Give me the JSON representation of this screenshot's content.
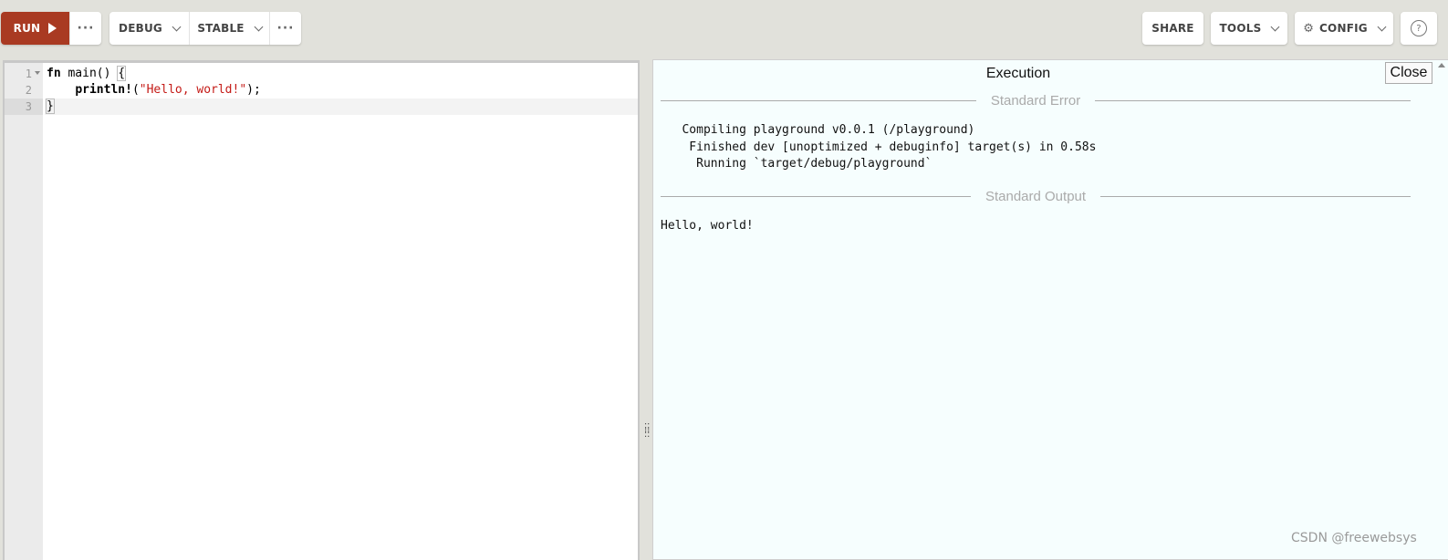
{
  "toolbar": {
    "run_label": "RUN",
    "run_more": "···",
    "mode_label": "DEBUG",
    "channel_label": "STABLE",
    "build_more": "···",
    "share_label": "SHARE",
    "tools_label": "TOOLS",
    "config_label": "CONFIG",
    "help_glyph": "?"
  },
  "editor": {
    "line_numbers": [
      "1",
      "2",
      "3"
    ],
    "code": {
      "line1_kw": "fn",
      "line1_rest": " main() ",
      "line1_brace": "{",
      "line2_indent": "    ",
      "line2_macro": "println!",
      "line2_open": "(",
      "line2_str": "\"Hello, world!\"",
      "line2_close": ");",
      "line3_brace": "}"
    }
  },
  "output": {
    "title": "Execution",
    "close_label": "Close",
    "stderr_label": "Standard Error",
    "stderr_lines": [
      "   Compiling playground v0.0.1 (/playground)",
      "    Finished dev [unoptimized + debuginfo] target(s) in 0.58s",
      "     Running `target/debug/playground`"
    ],
    "stdout_label": "Standard Output",
    "stdout_lines": [
      "Hello, world!"
    ]
  },
  "watermark": "CSDN @freewebsys",
  "colors": {
    "run_button": "#a93a22",
    "toolbar_bg": "#e1e1db",
    "output_bg": "#f6fefe",
    "string_literal": "#c41a16"
  }
}
